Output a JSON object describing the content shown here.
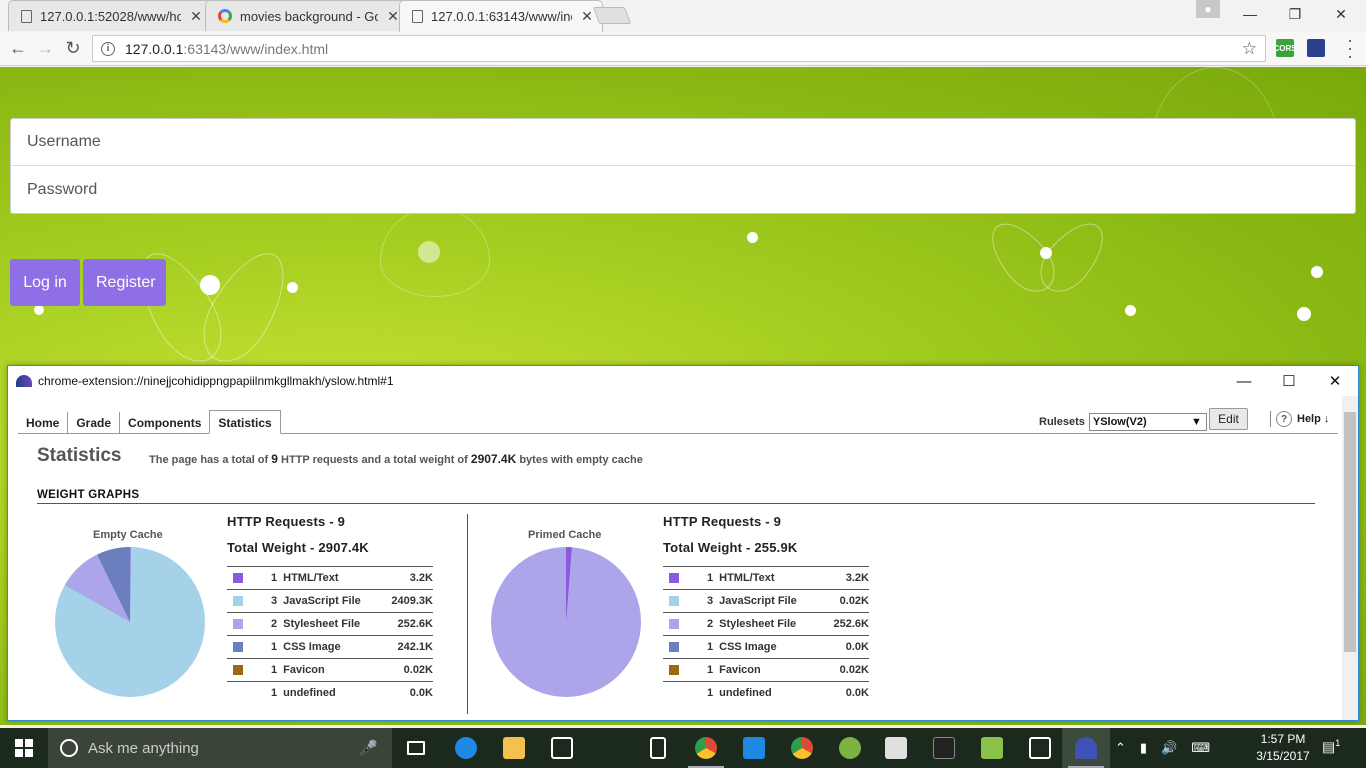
{
  "browser": {
    "tabs": [
      {
        "title": "127.0.0.1:52028/www/ho",
        "icon": "doc-icon",
        "active": false
      },
      {
        "title": "movies background - Go",
        "icon": "google-icon",
        "active": false
      },
      {
        "title": "127.0.0.1:63143/www/inc",
        "icon": "doc-icon",
        "active": true
      }
    ],
    "tab_close_glyph": "✕",
    "url_host": "127.0.0.1",
    "url_rest": ":63143/www/index.html",
    "extensions": [
      {
        "name": "cors-extension-icon",
        "label": "CORS",
        "color": "#3aa33a"
      },
      {
        "name": "yslow-extension-icon",
        "label": "",
        "color": "#2b3f8f"
      }
    ]
  },
  "login": {
    "username_placeholder": "Username",
    "password_placeholder": "Password",
    "login_label": "Log in",
    "register_label": "Register",
    "button_color": "#8e6fe6"
  },
  "yslow": {
    "window_title": "chrome-extension://ninejjcohidippngpapiilnmkgllmakh/yslow.html#1",
    "tabs": [
      "Home",
      "Grade",
      "Components",
      "Statistics"
    ],
    "active_tab": "Statistics",
    "rulesets_label": "Rulesets",
    "ruleset_value": "YSlow(V2)",
    "edit_label": "Edit",
    "help_label": "Help ↓",
    "statistics_title": "Statistics",
    "summary_pre": "The page has a total of",
    "summary_requests": "9",
    "summary_mid": "HTTP requests and a total weight of",
    "summary_weight": "2907.4K",
    "summary_post": "bytes with empty cache",
    "weight_graphs_heading": "WEIGHT GRAPHS",
    "empty_cache": {
      "label": "Empty Cache",
      "requests": "HTTP Requests - 9",
      "total_weight": "Total Weight - 2907.4K",
      "rows": [
        {
          "count": "1",
          "type": "HTML/Text",
          "size": "3.2K",
          "color": "#8b58df"
        },
        {
          "count": "3",
          "type": "JavaScript File",
          "size": "2409.3K",
          "color": "#a5d2e9"
        },
        {
          "count": "2",
          "type": "Stylesheet File",
          "size": "252.6K",
          "color": "#aca5ea"
        },
        {
          "count": "1",
          "type": "CSS Image",
          "size": "242.1K",
          "color": "#6b7fbf"
        },
        {
          "count": "1",
          "type": "Favicon",
          "size": "0.02K",
          "color": "#9a6a12"
        },
        {
          "count": "1",
          "type": "undefined",
          "size": "0.0K",
          "color": ""
        }
      ]
    },
    "primed_cache": {
      "label": "Primed Cache",
      "requests": "HTTP Requests - 9",
      "total_weight": "Total Weight - 255.9K",
      "rows": [
        {
          "count": "1",
          "type": "HTML/Text",
          "size": "3.2K",
          "color": "#8b58df"
        },
        {
          "count": "3",
          "type": "JavaScript File",
          "size": "0.02K",
          "color": "#a5d2e9"
        },
        {
          "count": "2",
          "type": "Stylesheet File",
          "size": "252.6K",
          "color": "#aca5ea"
        },
        {
          "count": "1",
          "type": "CSS Image",
          "size": "0.0K",
          "color": "#6b7fbf"
        },
        {
          "count": "1",
          "type": "Favicon",
          "size": "0.02K",
          "color": "#9a6a12"
        },
        {
          "count": "1",
          "type": "undefined",
          "size": "0.0K",
          "color": ""
        }
      ]
    }
  },
  "taskbar": {
    "search_placeholder": "Ask me anything",
    "time": "1:57 PM",
    "date": "3/15/2017",
    "notification_count": "1",
    "apps": [
      {
        "name": "task-view-icon",
        "color": "#ffffff",
        "open": false
      },
      {
        "name": "edge-icon",
        "color": "#1e88e5",
        "open": false
      },
      {
        "name": "file-explorer-icon",
        "color": "#f2c14e",
        "open": false
      },
      {
        "name": "store-icon",
        "color": "#ffffff",
        "open": false
      },
      {
        "name": "calculator-icon",
        "color": "#ffffff",
        "open": false
      },
      {
        "name": "chrome-icon",
        "color": "#dd4b39",
        "open": true
      },
      {
        "name": "app-icon",
        "color": "#1e88e5",
        "open": false
      },
      {
        "name": "chrome-icon-2",
        "color": "#dd4b39",
        "open": false
      },
      {
        "name": "android-studio-icon",
        "color": "#7cb342",
        "open": false
      },
      {
        "name": "document-app-icon",
        "color": "#e0e0e0",
        "open": false
      },
      {
        "name": "terminal-icon",
        "color": "#222222",
        "open": false
      },
      {
        "name": "green-app-icon",
        "color": "#8bc34a",
        "open": false
      },
      {
        "name": "photos-icon",
        "color": "#ffffff",
        "open": false
      },
      {
        "name": "yslow-taskbar-icon",
        "color": "#3f51b5",
        "open": true
      }
    ]
  }
}
